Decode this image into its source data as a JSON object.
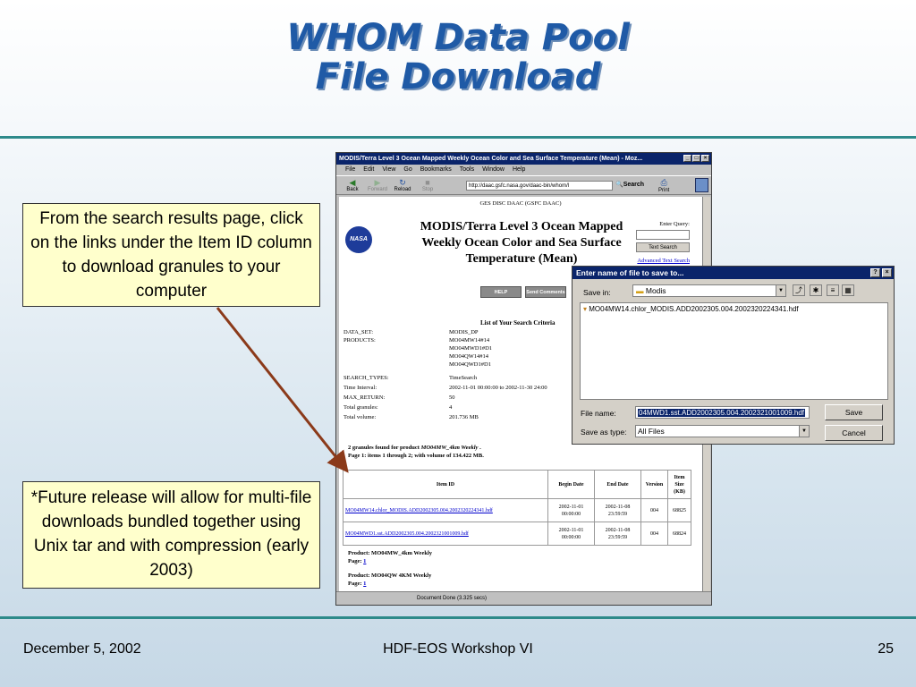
{
  "slide": {
    "title_line1": "WHOM Data Pool",
    "title_line2": "File Download",
    "note_top": "From the search results page, click on the links under the Item ID column to download granules to your computer",
    "note_bottom": "*Future release will allow for multi-file downloads bundled together using Unix tar and with compression (early 2003)",
    "footer_date": "December 5, 2002",
    "footer_event": "HDF-EOS Workshop VI",
    "footer_page": "25",
    "colors": {
      "title": "#1f5aa6",
      "rule": "#2d8a8a",
      "note_bg": "#ffffcc",
      "arrow": "#8b3a1a"
    }
  },
  "browser": {
    "window_title": "MODIS/Terra Level 3 Ocean Mapped Weekly Ocean Color and Sea Surface Temperature (Mean) - Moz...",
    "menu": [
      "File",
      "Edit",
      "View",
      "Go",
      "Bookmarks",
      "Tools",
      "Window",
      "Help"
    ],
    "nav": {
      "back": "Back",
      "forward": "Forward",
      "reload": "Reload",
      "stop": "Stop",
      "search": "Search",
      "print": "Print"
    },
    "url": "http://daac.gsfc.nasa.gov/daac-bin/whom/l",
    "status": "Document Done (3.325 secs)"
  },
  "page": {
    "header": "GES DISC DAAC (GSFC DAAC)",
    "logo": "NASA",
    "title": "MODIS/Terra Level 3 Ocean Mapped Weekly Ocean Color and Sea Surface Temperature (Mean)",
    "enter_query": "Enter Query:",
    "text_search_button": "Text Search",
    "advanced_link": "Advanced Text Search",
    "help_button": "HELP",
    "send_comments_button": "Send Comments",
    "criteria_title": "List of Your Search Criteria",
    "criteria": [
      {
        "key": "DATA_SET:",
        "value": "MODIS_DP"
      },
      {
        "key": "PRODUCTS:",
        "value": "MO04MW14#14"
      },
      {
        "key": "",
        "value": "MO04MWD1#D1"
      },
      {
        "key": "",
        "value": "MO04QW14#14"
      },
      {
        "key": "",
        "value": "MO04QWD1#D1"
      },
      {
        "key": "",
        "value": ""
      },
      {
        "key": "SEARCH_TYPES:",
        "value": "TimeSearch"
      },
      {
        "key": "Time Interval:",
        "value": "2002-11-01 00:00:00 to 2002-11-30 24:00"
      },
      {
        "key": "MAX_RETURN:",
        "value": "50"
      },
      {
        "key": "Total granules:",
        "value": "4"
      },
      {
        "key": "Total volume:",
        "value": "201.736 MB"
      }
    ],
    "found_line1_prefix": "2 granules found for product ",
    "found_product": "MO04MW_4km Weekly",
    "found_line1_suffix": " .",
    "found_line2": "Page 1: items 1 through 2; with volume of 134.422 MB.",
    "table": {
      "headers": [
        "Item ID",
        "Begin Date",
        "End Date",
        "Version",
        "Item Size (KB)"
      ],
      "rows": [
        {
          "id": "MO04MW14.chlor_MODIS.ADD2002305.004.2002320224341.hdf",
          "begin": "2002-11-01 00:00:00",
          "end": "2002-11-08 23:59:59",
          "version": "004",
          "size": "68825"
        },
        {
          "id": "MO04MWD1.sst.ADD2002305.004.2002321001009.hdf",
          "begin": "2002-11-01 00:00:00",
          "end": "2002-11-08 23:59:59",
          "version": "004",
          "size": "68824"
        }
      ]
    },
    "products": [
      {
        "label": "Product: MO04MW_4km Weekly",
        "page_label": "Page: ",
        "page_link": "1"
      },
      {
        "label": "Product: MO04QW 4KM Weekly",
        "page_label": "Page: ",
        "page_link": "1"
      }
    ]
  },
  "dialog": {
    "title": "Enter name of file to save to...",
    "save_in_label": "Save in:",
    "save_in_value": "Modis",
    "files": [
      "MO04MW14.chlor_MODIS.ADD2002305.004.2002320224341.hdf"
    ],
    "file_name_label": "File name:",
    "file_name_value": "04MWD1.sst.ADD2002305.004.2002321001009.hdf",
    "save_as_type_label": "Save as type:",
    "save_as_type_value": "All Files",
    "save_button": "Save",
    "cancel_button": "Cancel"
  }
}
